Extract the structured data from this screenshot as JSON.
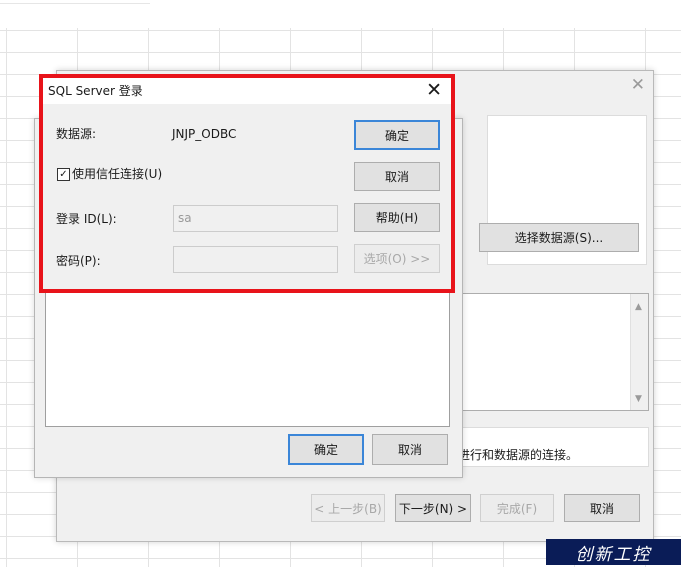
{
  "wizard": {
    "close_glyph": "✕",
    "select_datasource_label": "选择数据源(S)...",
    "description_text": "进行和数据源的连接。",
    "back_label": "< 上一步(B)",
    "next_label": "下一步(N) >",
    "finish_label": "完成(F)",
    "cancel_label": "取消"
  },
  "odbc": {
    "ok_label": "确定",
    "cancel_label": "取消"
  },
  "login": {
    "title": "SQL Server 登录",
    "close_glyph": "✕",
    "datasource_label": "数据源:",
    "datasource_value": "JNJP_ODBC",
    "trusted_label": "使用信任连接(U)",
    "trusted_checked": true,
    "login_id_label": "登录 ID(L):",
    "login_id_value": "sa",
    "password_label": "密码(P):",
    "password_value": "",
    "ok_label": "确定",
    "cancel_label": "取消",
    "help_label": "帮助(H)",
    "options_label": "选项(O) >>"
  },
  "highlight_color": "#e8131a",
  "watermark_text": "创新工控"
}
